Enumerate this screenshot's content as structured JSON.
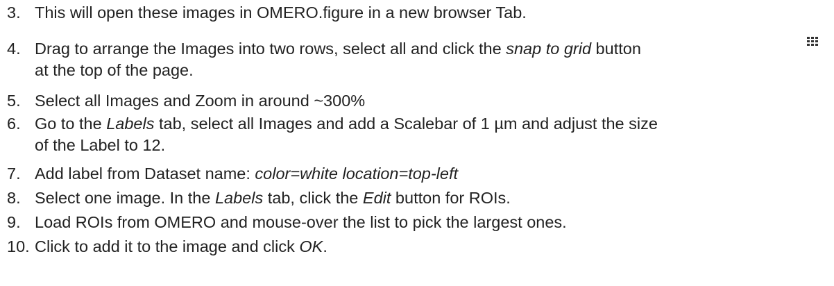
{
  "steps": [
    {
      "number": "3.",
      "text": "This will open these images in OMERO.figure in a new browser Tab."
    },
    {
      "number": "4.",
      "text_a": "Drag to arrange the Images into two rows, select all and click the ",
      "text_em": "snap to grid",
      "text_b": " button",
      "text_cont": "at the top of the page."
    },
    {
      "number": "5.",
      "text": "Select all Images and Zoom in around ~300%"
    },
    {
      "number": "6.",
      "text_a": "Go to the ",
      "text_em": "Labels",
      "text_b": " tab, select all Images and add a Scalebar of 1 µm and adjust the size",
      "text_cont": "of the Label to 12."
    },
    {
      "number": "7.",
      "text_a": "Add label from Dataset name: ",
      "text_em": "color=white location=top-left"
    },
    {
      "number": "8.",
      "text_a": "Select one image. In the ",
      "text_em": "Labels",
      "text_b": " tab, click the ",
      "text_em2": "Edit",
      "text_c": " button for ROIs."
    },
    {
      "number": "9.",
      "text": "Load ROIs from OMERO and mouse-over the list to pick the largest ones."
    },
    {
      "number": "10.",
      "text_a": "Click to add it to the image and click ",
      "text_em": "OK",
      "text_b": "."
    }
  ],
  "icons": {
    "snap_to_grid": "grid-icon"
  },
  "colors": {
    "text": "#222222",
    "icon": "#333333"
  }
}
